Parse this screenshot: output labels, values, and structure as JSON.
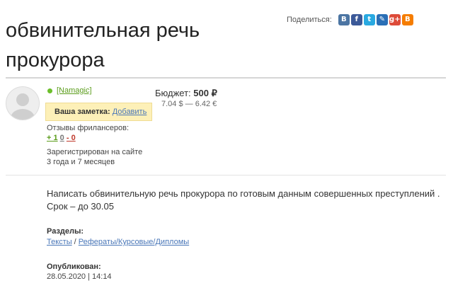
{
  "title": "обвинительная речь прокурора",
  "share": {
    "label": "Поделиться:",
    "icons": [
      {
        "name": "vk-icon",
        "glyph": "B",
        "color": "#4c75a3"
      },
      {
        "name": "facebook-icon",
        "glyph": "f",
        "color": "#3b5998"
      },
      {
        "name": "twitter-icon",
        "glyph": "t",
        "color": "#29a9e1"
      },
      {
        "name": "livejournal-icon",
        "glyph": "✎",
        "color": "#2a6fb6"
      },
      {
        "name": "googleplus-icon",
        "glyph": "g+",
        "color": "#dd4b39"
      },
      {
        "name": "blogger-icon",
        "glyph": "B",
        "color": "#f57d00"
      }
    ]
  },
  "user": {
    "name": "[Namagic]",
    "note_label": "Ваша заметка:",
    "note_link": "Добавить",
    "reviews_label": "Отзывы фрилансеров:",
    "reviews_positive": "+ 1",
    "reviews_neutral": "0",
    "reviews_negative": "- 0",
    "registered_line1": "Зарегистрирован на сайте",
    "registered_line2": "3 года и 7 месяцев"
  },
  "budget": {
    "label": "Бюджет:",
    "value": "500 ₽",
    "converted": "7.04 $ — 6.42 €"
  },
  "description": {
    "line1": "Написать обвинительную речь прокурора по готовым данным совершенных преступлений .",
    "line2": "Срок – до 30.05"
  },
  "sections": {
    "label": "Разделы:",
    "link1": "Тексты",
    "separator": " / ",
    "link2": "Рефераты/Курсовые/Дипломы"
  },
  "published": {
    "label": "Опубликован:",
    "value": "28.05.2020 | 14:14"
  }
}
